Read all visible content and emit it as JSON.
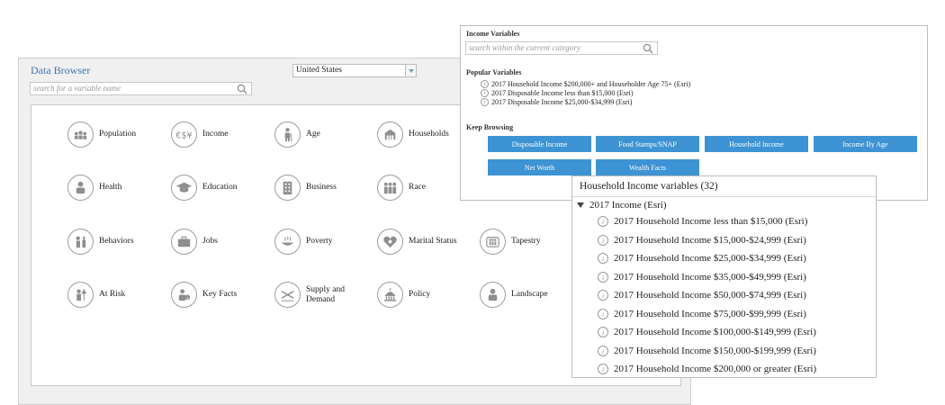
{
  "data_browser": {
    "title": "Data Browser",
    "search_placeholder": "search for a variable name",
    "country_selected": "United States",
    "categories": [
      {
        "label": "Population",
        "icon": "population-icon"
      },
      {
        "label": "Income",
        "icon": "income-icon"
      },
      {
        "label": "Age",
        "icon": "age-icon"
      },
      {
        "label": "Households",
        "icon": "households-icon"
      },
      {
        "label": "Health",
        "icon": "health-icon"
      },
      {
        "label": "Education",
        "icon": "education-icon"
      },
      {
        "label": "Business",
        "icon": "business-icon"
      },
      {
        "label": "Race",
        "icon": "race-icon"
      },
      {
        "label": "Behaviors",
        "icon": "behaviors-icon"
      },
      {
        "label": "Jobs",
        "icon": "jobs-icon"
      },
      {
        "label": "Poverty",
        "icon": "poverty-icon"
      },
      {
        "label": "Marital Status",
        "icon": "marital-status-icon"
      },
      {
        "label": "Tapestry",
        "icon": "tapestry-icon"
      },
      {
        "label": "At Risk",
        "icon": "at-risk-icon"
      },
      {
        "label": "Key Facts",
        "icon": "key-facts-icon"
      },
      {
        "label": "Supply and Demand",
        "icon": "supply-demand-icon"
      },
      {
        "label": "Policy",
        "icon": "policy-icon"
      },
      {
        "label": "Landscape",
        "icon": "landscape-icon"
      }
    ]
  },
  "income_panel": {
    "title": "Income Variables",
    "search_placeholder": "search within the current category",
    "popular_heading": "Popular Variables",
    "popular": [
      "2017 Household Income $200,000+ and Householder Age 75+ (Esri)",
      "2017 Disposable Income less than $15,000 (Esri)",
      "2017 Disposable Income $25,000-$34,999 (Esri)"
    ],
    "keep_browsing_heading": "Keep Browsing",
    "browse_buttons": [
      "Disposable Income",
      "Food Stamps/SNAP",
      "Household Income",
      "Income By Age",
      "Net Worth",
      "Wealth Facts"
    ],
    "button_color": "#3d93d3"
  },
  "household_panel": {
    "title": "Household Income variables (32)",
    "group": "2017 Income (Esri)",
    "items": [
      "2017 Household Income less than $15,000 (Esri)",
      "2017 Household Income $15,000-$24,999 (Esri)",
      "2017 Household Income $25,000-$34,999 (Esri)",
      "2017 Household Income $35,000-$49,999 (Esri)",
      "2017 Household Income $50,000-$74,999 (Esri)",
      "2017 Household Income $75,000-$99,999 (Esri)",
      "2017 Household Income $100,000-$149,999 (Esri)",
      "2017 Household Income $150,000-$199,999 (Esri)",
      "2017 Household Income $200,000 or greater (Esri)"
    ]
  }
}
